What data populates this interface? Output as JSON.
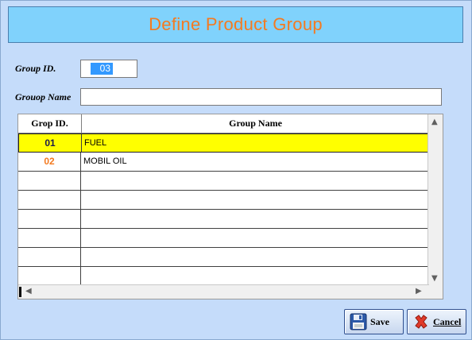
{
  "window": {
    "title": "Define Product Group"
  },
  "form": {
    "group_id_label": "Group ID.",
    "group_id_value": "03",
    "group_name_label": "Grouop Name",
    "group_name_value": ""
  },
  "grid": {
    "columns": [
      "Grop ID.",
      "Group Name"
    ],
    "rows": [
      {
        "id": "01",
        "name": "FUEL",
        "selected": true
      },
      {
        "id": "02",
        "name": "MOBIL OIL",
        "selected": false
      }
    ],
    "empty_rows": 6
  },
  "buttons": {
    "save_label": "Save",
    "cancel_label": "Cancel"
  },
  "icons": {
    "save": "floppy-disk-icon",
    "cancel": "red-x-icon"
  },
  "colors": {
    "background": "#c5dcfa",
    "title_banner": "#80d2fc",
    "title_text": "#f47a20",
    "selected_row": "#ffff00",
    "selection_highlight": "#3399ff"
  }
}
